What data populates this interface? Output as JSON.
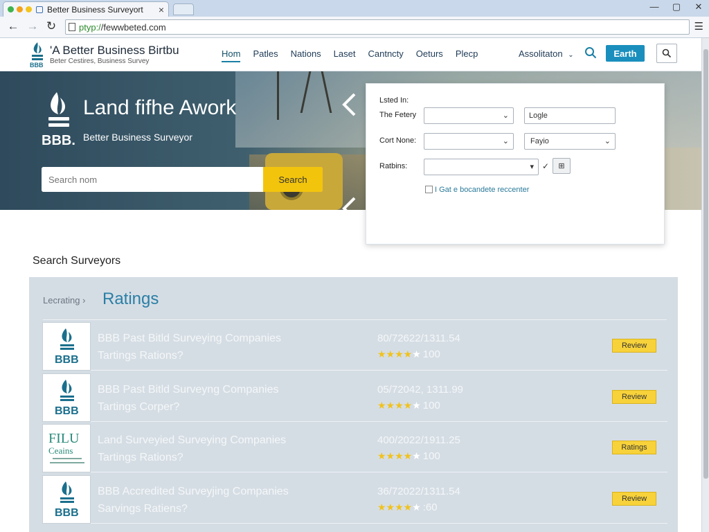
{
  "browser": {
    "tab_title": "Better Business Surveyort",
    "tab_close": "×",
    "url_scheme": "ptyp:/",
    "url_rest": "/fewwbeted.com",
    "controls": {
      "minimize": "—",
      "restore": "▢",
      "close": "✕"
    }
  },
  "header": {
    "brand_title": "Better Business Birtbu",
    "brand_prefix": "'A",
    "brand_sub": "Beter Cestires, Business Survey",
    "nav": [
      "Hom",
      "Patles",
      "Nations",
      "Laset",
      "Cantncty",
      "Oeturs",
      "Plecp"
    ],
    "assoc_label": "Assolitaton",
    "earth_button": "Earth"
  },
  "hero": {
    "title": "Land fifhe Awork",
    "logo_text": "BBB.",
    "subtitle": "Better Business Surveyor",
    "search_placeholder": "Search nom",
    "search_button": "Search"
  },
  "filters": {
    "listed_in_label": "Lsted In:",
    "row1_label": "The Fetery",
    "row1_select": "",
    "row1_input": "Logle",
    "row2_label": "Cort None:",
    "row2_select": "",
    "row2_select_b": "Fayio",
    "row3_label": "Ratbins:",
    "row3_select": "",
    "check_mark": "✓",
    "small_button": "⊞",
    "checkbox_label": "I Gat e bocandete reccenter"
  },
  "results": {
    "section_title": "Search Surveyors",
    "crumb": "Lecrating ›",
    "heading": "Ratings",
    "rows": [
      {
        "title": "BBB Past Bitld Surveying Companies",
        "sub": "Tartings Rations?",
        "date": "80/72622/1311.54",
        "stars_on": 4,
        "score": "100",
        "button": "Review",
        "logo": "BBB"
      },
      {
        "title": "BBB Past Bitld Surveyng Companies",
        "sub": "Tartings Corper?",
        "date": "05/72042, 1311.99",
        "stars_on": 4,
        "score": "100",
        "button": "Review",
        "logo": "BBB"
      },
      {
        "title": "Land Surveyied Surveying Companies",
        "sub": "Tartings Rations?",
        "date": "400/2022/1911.25",
        "stars_on": 4,
        "score": "100",
        "button": "Ratings",
        "logo": "FILU"
      },
      {
        "title": "BBB Accredited Surveyjing Companies",
        "sub": "Sarvings Ratiens?",
        "date": "36/72022/1311.54",
        "stars_on": 4,
        "score": ":60",
        "button": "Review",
        "logo": "BBB"
      }
    ],
    "filu_logo_sub": "Ceains"
  },
  "colors": {
    "accent": "#1a8fbd",
    "rating_star": "#f1c21b",
    "review_button": "#f7d23a",
    "panel_bg": "#d5dde4"
  }
}
